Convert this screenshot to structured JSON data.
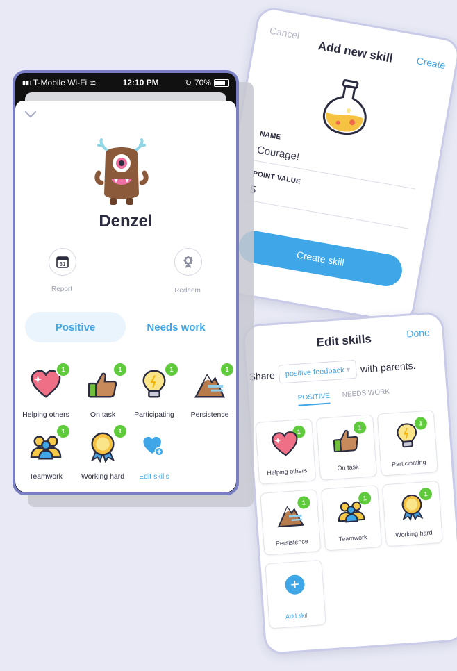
{
  "add_skill": {
    "cancel_label": "Cancel",
    "title": "Add new skill",
    "create_label": "Create",
    "icon": "flask-icon",
    "name_label": "NAME",
    "name_value": "Courage!",
    "points_label": "POINT VALUE",
    "points_value": "5",
    "submit_label": "Create skill"
  },
  "edit_skills": {
    "title": "Edit skills",
    "done_label": "Done",
    "share_prefix": "Share",
    "share_value": "positive feedback",
    "share_suffix": "with parents.",
    "tabs": [
      {
        "label": "POSITIVE"
      },
      {
        "label": "NEEDS WORK"
      }
    ],
    "skills": [
      {
        "name": "Helping others",
        "badge": "1",
        "icon": "heart-icon"
      },
      {
        "name": "On task",
        "badge": "1",
        "icon": "thumbs-up-icon"
      },
      {
        "name": "Participating",
        "badge": "1",
        "icon": "lightbulb-icon"
      },
      {
        "name": "Persistence",
        "badge": "1",
        "icon": "mountain-icon"
      },
      {
        "name": "Teamwork",
        "badge": "1",
        "icon": "team-icon"
      },
      {
        "name": "Working hard",
        "badge": "1",
        "icon": "medal-icon"
      }
    ],
    "add_label": "Add skill"
  },
  "phone": {
    "status": {
      "carrier": "T-Mobile Wi-Fi",
      "time": "12:10 PM",
      "battery": "70%"
    },
    "student_name": "Denzel",
    "report_label": "Report",
    "calendar_day": "31",
    "redeem_label": "Redeem",
    "segment": {
      "positive": "Positive",
      "needs_work": "Needs work"
    },
    "skills": [
      {
        "name": "Helping others",
        "badge": "1",
        "icon": "heart-icon"
      },
      {
        "name": "On task",
        "badge": "1",
        "icon": "thumbs-up-icon"
      },
      {
        "name": "Participating",
        "badge": "1",
        "icon": "lightbulb-icon"
      },
      {
        "name": "Persistence",
        "badge": "1",
        "icon": "mountain-icon"
      },
      {
        "name": "Teamwork",
        "badge": "1",
        "icon": "team-icon"
      },
      {
        "name": "Working hard",
        "badge": "1",
        "icon": "medal-icon"
      }
    ],
    "edit_label": "Edit skills"
  },
  "colors": {
    "accent": "#3fa7e8",
    "badge": "#5fcb3c",
    "phone_border": "#7a7ec2",
    "text": "#2b2c40"
  }
}
